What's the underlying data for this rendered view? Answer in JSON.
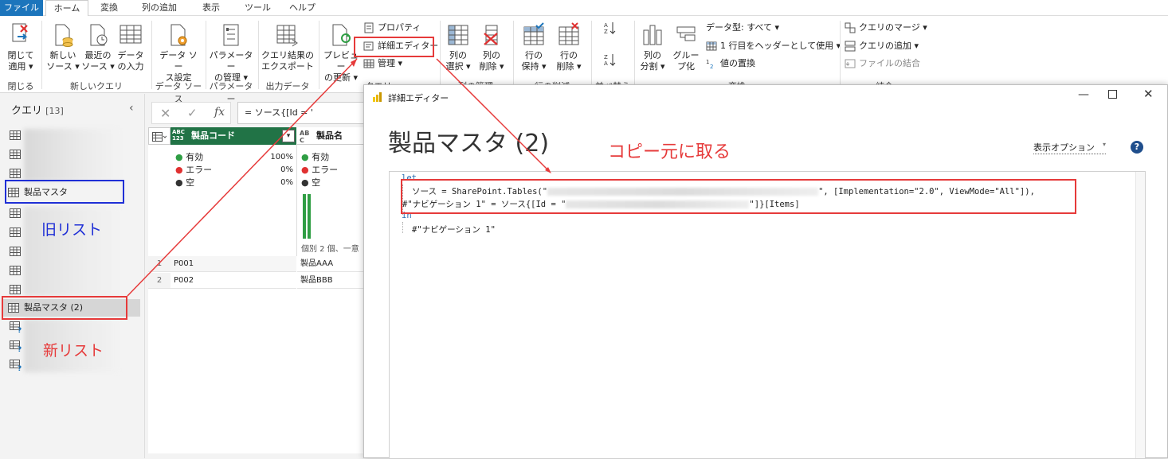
{
  "menu": {
    "tabs": [
      "ファイル",
      "ホーム",
      "変換",
      "列の追加",
      "表示",
      "ツール",
      "ヘルプ"
    ],
    "active": "ホーム"
  },
  "ribbon": {
    "close_apply": [
      "閉じて",
      "適用 ▾"
    ],
    "close_group": "閉じる",
    "new_source": [
      "新しい",
      "ソース ▾"
    ],
    "recent_source": [
      "最近の",
      "ソース ▾"
    ],
    "enter_data": [
      "データ",
      "の入力"
    ],
    "new_query_group": "新しいクエリ",
    "datasource_settings": [
      "データ ソー",
      "ス設定"
    ],
    "datasource_group": "データ ソース",
    "param_manage": [
      "パラメーター",
      "の管理 ▾"
    ],
    "param_group": "パラメーター",
    "export": [
      "クエリ結果の",
      "エクスポート"
    ],
    "export_group": "出力データ",
    "preview": [
      "プレビュー",
      "の更新 ▾"
    ],
    "property": "プロパティ",
    "advanced_editor": "詳細エディター",
    "manage": "管理 ▾",
    "query_group": "クエリ",
    "choose_cols": [
      "列の",
      "選択 ▾"
    ],
    "remove_cols": [
      "列の",
      "削除 ▾"
    ],
    "cols_group": "列の管理",
    "keep_rows": [
      "行の",
      "保持 ▾"
    ],
    "remove_rows": [
      "行の",
      "削除 ▾"
    ],
    "rows_group": "行の削減",
    "sort_group": "並べ替え",
    "split_col": [
      "列の",
      "分割 ▾"
    ],
    "group_by": [
      "グルー",
      "プ化"
    ],
    "datatype": "データ型: すべて ▾",
    "first_row_header": "1 行目をヘッダーとして使用 ▾",
    "replace_values": "値の置換",
    "transform_group": "変換",
    "merge_queries": "クエリのマージ ▾",
    "append_queries": "クエリの追加 ▾",
    "combine_files": "ファイルの結合",
    "combine_group": "結合"
  },
  "queries": {
    "title": "クエリ",
    "count": "[13]",
    "item_product_master": "製品マスタ",
    "item_product_master_2": "製品マスタ (2)",
    "annotation_old": "旧リスト",
    "annotation_new": "新リスト"
  },
  "formula": {
    "text": "= ソース{[Id = '"
  },
  "grid": {
    "col1_type": "ABC\n123",
    "col1_name": "製品コード",
    "col2_type": "AB\nC",
    "col2_name": "製品名",
    "valid": "有効",
    "error": "エラー",
    "empty": "空",
    "pct_valid": "100%",
    "pct_error": "0%",
    "pct_empty": "0%",
    "distinct_note": "個別 2 個、一意",
    "rows": [
      {
        "n": "1",
        "code": "P001",
        "name": "製品AAA"
      },
      {
        "n": "2",
        "code": "P002",
        "name": "製品BBB"
      }
    ]
  },
  "dialog": {
    "title": "詳細エディター",
    "heading": "製品マスタ (2)",
    "annotation": "コピー元に取る",
    "view_options": "表示オプション",
    "code": {
      "let": "let",
      "line1_a": "ソース = SharePoint.Tables(\"",
      "line1_b": "\", [Implementation=\"2.0\", ViewMode=\"All\"]),",
      "line2_a": "#\"ナビゲーション 1\" = ソース{[Id = \"",
      "line2_b": "\"]}[Items]",
      "in": "in",
      "line3": "#\"ナビゲーション 1\""
    }
  },
  "colors": {
    "accent": "#1c75bc",
    "header_green": "#217346",
    "annotation_red": "#e63a3a",
    "annotation_blue": "#1f2fd6"
  }
}
